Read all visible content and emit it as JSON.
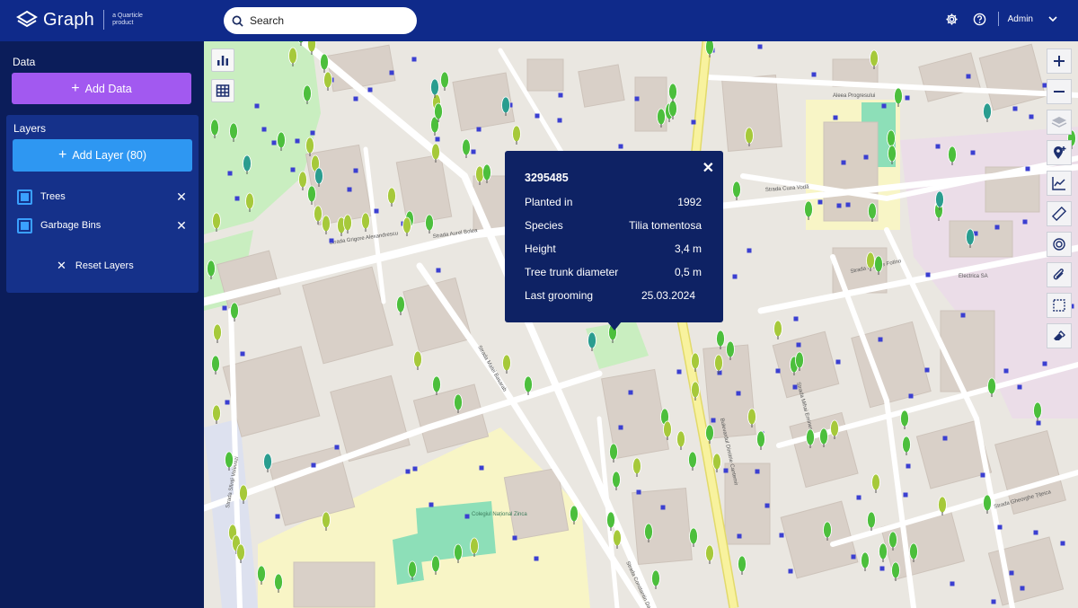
{
  "header": {
    "logo_text": "Graph",
    "logo_sub": "a Quarticle product",
    "search_placeholder": "Search",
    "user_name": "Admin"
  },
  "sidebar": {
    "data_title": "Data",
    "add_data_label": "Add Data",
    "layers_title": "Layers",
    "add_layer_label": "Add Layer (80)",
    "layers": [
      {
        "label": "Trees",
        "checked": true
      },
      {
        "label": "Garbage Bins",
        "checked": true
      }
    ],
    "reset_label": "Reset Layers"
  },
  "popup": {
    "id": "3295485",
    "rows": [
      {
        "label": "Planted in",
        "value": "1992"
      },
      {
        "label": "Species",
        "value": "Tilia tomentosa"
      },
      {
        "label": "Height",
        "value": "3,4 m"
      },
      {
        "label": "Tree trunk diameter",
        "value": "0,5 m"
      },
      {
        "label": "Last grooming",
        "value": "25.03.2024"
      }
    ]
  },
  "map": {
    "street_labels": [
      "Strada Aurel Bolea",
      "Strada Grigore Alexandrescu",
      "Aleea Progresului",
      "Strada Cuza Vodă",
      "Bulevardul Dimitrie Cantemir",
      "Strada Matei Basarab",
      "Strada Constantin Daniel",
      "Strada Sfinții Voievozi",
      "Strada Nicolae Fotino",
      "Strada Mihai Eminescu",
      "Strada Gheorghe Țițeica"
    ],
    "poi_labels": [
      "Colegiul Național Zinca",
      "Electrica SA"
    ],
    "tools": [
      "zoom-in",
      "zoom-out",
      "layers",
      "add-marker",
      "chart-line",
      "ruler",
      "target",
      "paperclip",
      "select-area",
      "eraser"
    ],
    "colors": {
      "tree_light": "#a6c93a",
      "tree_green": "#4cbf3c",
      "tree_teal": "#2a9d8f",
      "bin": "#3b3fd1",
      "road_yellow": "#f7f2a0"
    }
  }
}
